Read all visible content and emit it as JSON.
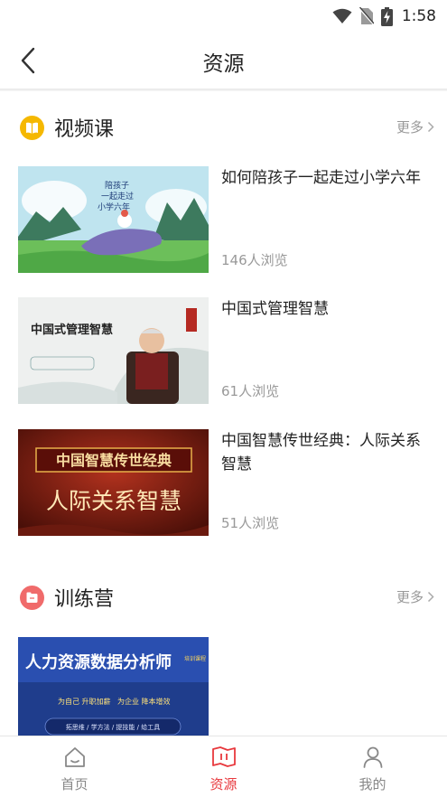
{
  "status": {
    "time": "1:58"
  },
  "header": {
    "title": "资源"
  },
  "sections": {
    "video": {
      "title": "视频课",
      "more": "更多"
    },
    "camp": {
      "title": "训练营",
      "more": "更多"
    }
  },
  "videos": [
    {
      "title": "如何陪孩子一起走过小学六年",
      "views": "146人浏览",
      "thumb_text": [
        "陪孩子",
        "一起走过",
        "小学六年"
      ]
    },
    {
      "title": "中国式管理智慧",
      "views": "61人浏览",
      "thumb_text": [
        "中国式管理智慧"
      ]
    },
    {
      "title": "中国智慧传世经典：人际关系智慧",
      "views": "51人浏览",
      "thumb_text": [
        "中国智慧传世经典",
        "人际关系智慧"
      ]
    }
  ],
  "camps": [
    {
      "thumb_text": [
        "人力资源数据分析师",
        "培训课程",
        "为自己 升职加薪",
        "为企业 降本增效",
        "拓思维 / 学方法 / 提技能 / 给工具"
      ]
    }
  ],
  "tabbar": {
    "home": "首页",
    "resources": "资源",
    "mine": "我的"
  },
  "colors": {
    "accent": "#e8383d",
    "video_icon": "#f5b800",
    "camp_icon": "#f06b6b"
  }
}
